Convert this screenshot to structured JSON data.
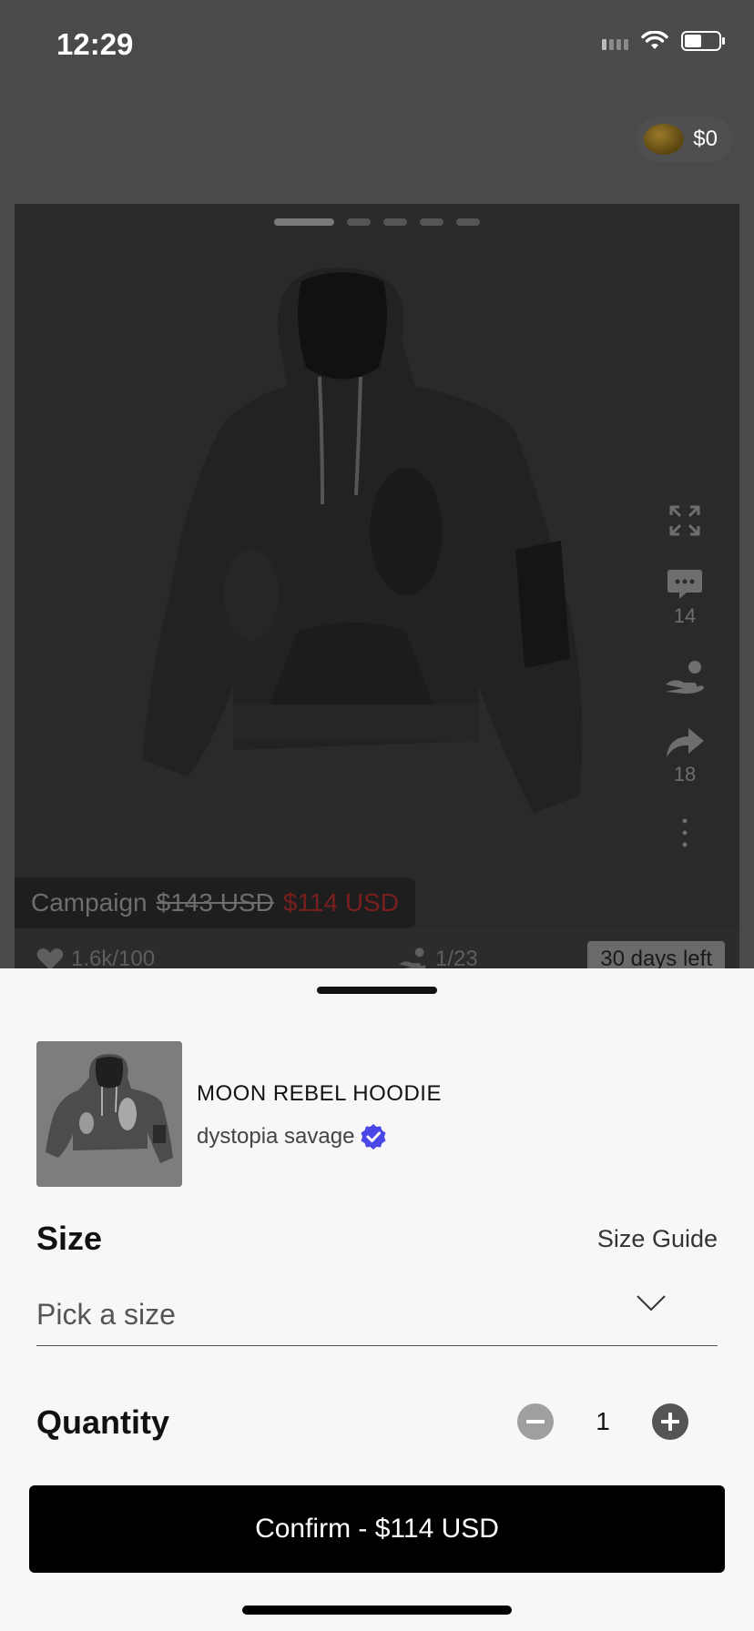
{
  "status_bar": {
    "time": "12:29"
  },
  "wallet": {
    "balance": "$0",
    "icon": "coin-icon"
  },
  "hero": {
    "pager": {
      "count": 5,
      "active_index": 0
    },
    "actions": [
      {
        "icon": "expand-icon",
        "count": ""
      },
      {
        "icon": "comment-icon",
        "count": "14"
      },
      {
        "icon": "support-icon",
        "count": ""
      },
      {
        "icon": "share-icon",
        "count": "18"
      },
      {
        "icon": "more-icon",
        "count": ""
      }
    ],
    "campaign": {
      "label": "Campaign",
      "original_price": "$143 USD",
      "sale_price": "$114 USD"
    },
    "likes": "1.6k/100",
    "backers": "1/23",
    "days_left": "30 days left"
  },
  "sheet": {
    "product": {
      "name": "MOON REBEL HOODIE",
      "seller": "dystopia savage",
      "verified": true
    },
    "size": {
      "title": "Size",
      "guide_label": "Size Guide",
      "placeholder": "Pick a size"
    },
    "quantity": {
      "title": "Quantity",
      "value": "1"
    },
    "confirm_label": "Confirm - $114 USD"
  },
  "colors": {
    "overlay": "#4a4a4a",
    "sheet_bg": "#f7f7f7",
    "sale_red": "#7a1f1f",
    "verified_blue": "#4b47e6",
    "confirm_bg": "#000000"
  }
}
